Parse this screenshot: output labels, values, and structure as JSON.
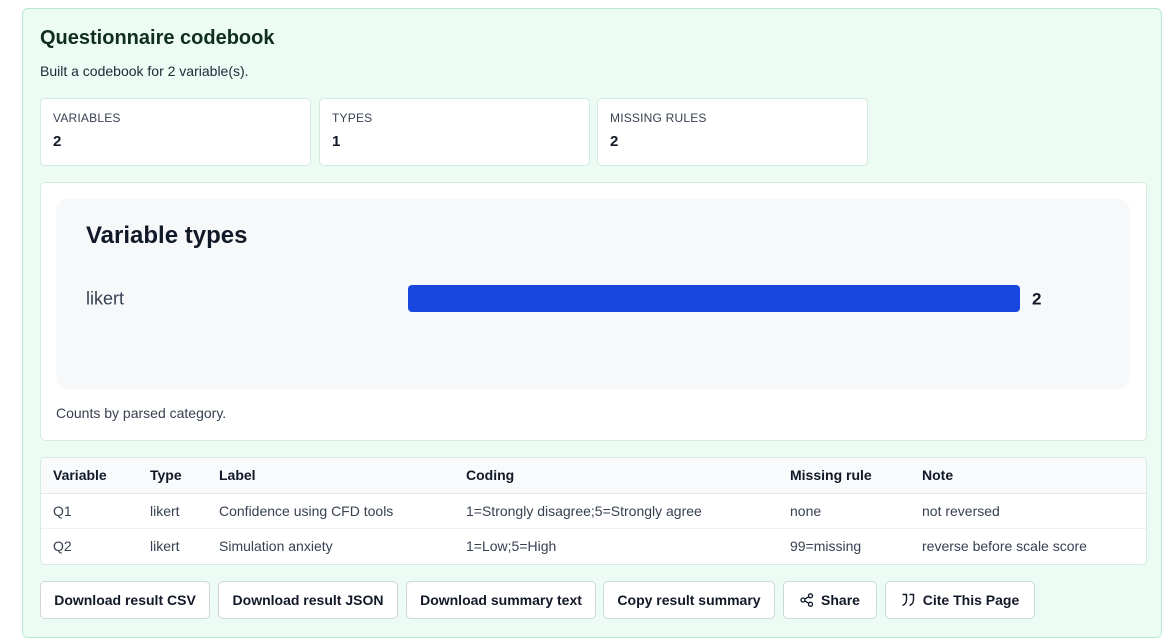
{
  "header": {
    "title": "Questionnaire codebook",
    "subtitle": "Built a codebook for 2 variable(s)."
  },
  "stats": [
    {
      "label": "VARIABLES",
      "value": "2"
    },
    {
      "label": "TYPES",
      "value": "1"
    },
    {
      "label": "MISSING RULES",
      "value": "2"
    }
  ],
  "chart_data": {
    "type": "bar",
    "orientation": "horizontal",
    "title": "Variable types",
    "categories": [
      "likert"
    ],
    "values": [
      2
    ],
    "xlim": [
      0,
      2
    ],
    "grid": false,
    "bar_color": "#1847e0",
    "caption": "Counts by parsed category."
  },
  "table": {
    "headers": [
      "Variable",
      "Type",
      "Label",
      "Coding",
      "Missing rule",
      "Note"
    ],
    "rows": [
      [
        "Q1",
        "likert",
        "Confidence using CFD tools",
        "1=Strongly disagree;5=Strongly agree",
        "none",
        "not reversed"
      ],
      [
        "Q2",
        "likert",
        "Simulation anxiety",
        "1=Low;5=High",
        "99=missing",
        "reverse before scale score"
      ]
    ]
  },
  "actions": {
    "download_csv": "Download result CSV",
    "download_json": "Download result JSON",
    "download_summary": "Download summary text",
    "copy_summary": "Copy result summary",
    "share": "Share",
    "cite": "Cite This Page",
    "share_icon": "share-icon",
    "cite_icon": "quote-icon"
  },
  "colors": {
    "panel_bg": "#ecfbf3",
    "bar": "#1847e0"
  }
}
